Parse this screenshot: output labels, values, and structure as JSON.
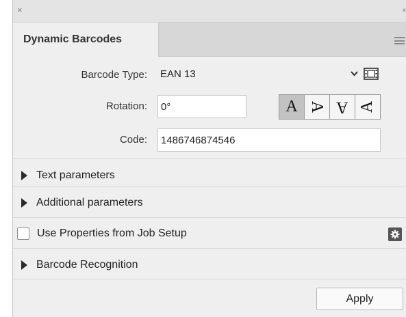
{
  "window": {
    "close_glyph": "×",
    "collapse_glyph": "‹‹"
  },
  "tab": {
    "title": "Dynamic Barcodes"
  },
  "fields": {
    "barcode_type_label": "Barcode Type:",
    "barcode_type_value": "EAN 13",
    "rotation_label": "Rotation:",
    "rotation_value": "0°",
    "code_label": "Code:",
    "code_value": "1486746874546"
  },
  "rotation_buttons": [
    {
      "glyph": "A",
      "active": true
    },
    {
      "glyph": "A",
      "active": false
    },
    {
      "glyph": "A",
      "active": false
    },
    {
      "glyph": "A",
      "active": false
    }
  ],
  "sections": {
    "text_parameters": "Text parameters",
    "additional_parameters": "Additional parameters",
    "barcode_recognition": "Barcode Recognition"
  },
  "job_setup": {
    "label": "Use Properties from Job Setup",
    "checked": false
  },
  "actions": {
    "apply_label": "Apply"
  },
  "colors": {
    "panel_bg": "#efefef",
    "tab_strip": "#d7d7d7",
    "active_rotation": "#c2c2c2",
    "gear_button": "#555555"
  },
  "icons": {
    "close": "close-icon",
    "collapse": "double-chevron-left-icon",
    "menu": "hamburger-menu-icon",
    "dropdown": "chevron-down-icon",
    "barcode_preview": "film-strip-icon",
    "disclosure": "triangle-right-icon",
    "settings": "gear-icon"
  }
}
